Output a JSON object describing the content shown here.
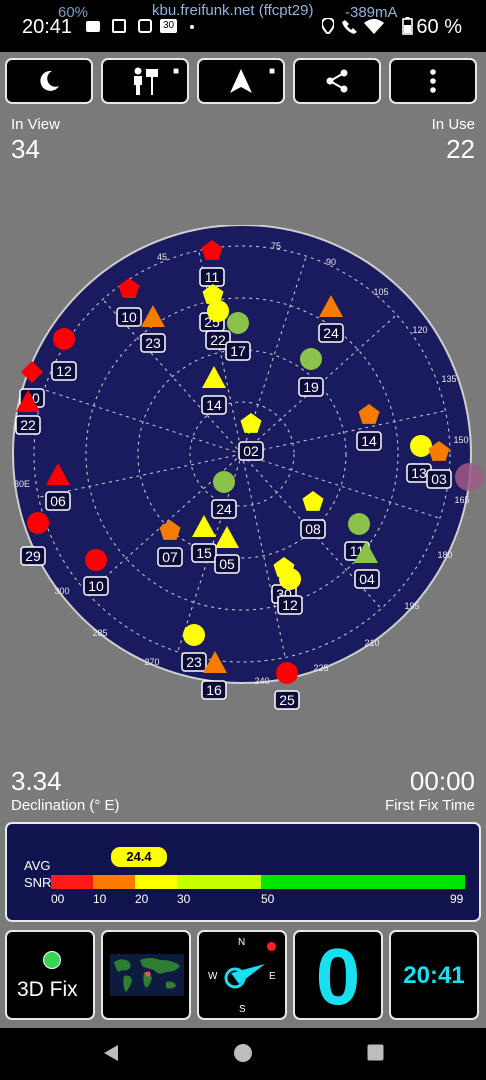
{
  "status_bar": {
    "time": "20:41",
    "battery_overlay": "60%",
    "host_info": "kbu.freifunk.net (ffcpt29)",
    "current": "-389mA",
    "battery": "60 %",
    "date_badge": "30",
    "left_icons": [
      "message-icon",
      "calendar-icon",
      "app-icon",
      "calendar-date-icon"
    ],
    "right_icons": [
      "location-icon",
      "wifi-calling-icon",
      "wifi-icon",
      "battery-icon"
    ]
  },
  "toolbar": {
    "buttons": [
      {
        "name": "night-mode-button",
        "icon": "moon-icon",
        "glyph": "☾",
        "locked": false
      },
      {
        "name": "map-guide-button",
        "icon": "person-sign-icon",
        "glyph": "⚑",
        "locked": true
      },
      {
        "name": "navigate-button",
        "icon": "navigation-arrow-icon",
        "glyph": "▲",
        "locked": true
      },
      {
        "name": "share-button",
        "icon": "share-icon",
        "glyph": "⋖",
        "locked": false
      },
      {
        "name": "menu-button",
        "icon": "more-vert-icon",
        "glyph": "⋮",
        "locked": false
      }
    ],
    "lock_glyph": "🔒"
  },
  "stats": {
    "in_view_label": "In View",
    "in_view_value": "34",
    "in_use_label": "In Use",
    "in_use_value": "22",
    "declination_value": "3.34",
    "declination_label": "Declination (° E)",
    "first_fix_value": "00:00",
    "first_fix_label": "First Fix Time"
  },
  "radar": {
    "azimuth_labels": [
      "45",
      "75",
      "90",
      "105",
      "120",
      "135",
      "150",
      "165",
      "180",
      "195",
      "210",
      "225",
      "240",
      "270",
      "285",
      "300",
      "30E"
    ],
    "colors": {
      "red": "#ff0000",
      "orange": "#f57c00",
      "yellow": "#ffff00",
      "lime": "#8bc34a",
      "green": "#7fd10e",
      "bg": "#1a1a5e"
    },
    "satellites": [
      {
        "label": "11",
        "shape": "pentagon",
        "color": "red"
      },
      {
        "label": "10",
        "shape": "pentagon",
        "color": "red"
      },
      {
        "label": "23",
        "shape": "triangle",
        "color": "orange"
      },
      {
        "label": "25",
        "shape": "pentagon",
        "color": "yellow"
      },
      {
        "label": "22",
        "shape": "circle",
        "color": "yellow"
      },
      {
        "label": "17",
        "shape": "circle",
        "color": "lime"
      },
      {
        "label": "24",
        "shape": "triangle",
        "color": "orange"
      },
      {
        "label": "19",
        "shape": "circle",
        "color": "lime"
      },
      {
        "label": "12",
        "shape": "circle",
        "color": "red"
      },
      {
        "label": "20",
        "shape": "diamond",
        "color": "red"
      },
      {
        "label": "22",
        "shape": "triangle",
        "color": "red"
      },
      {
        "label": "14",
        "shape": "triangle",
        "color": "yellow"
      },
      {
        "label": "14",
        "shape": "pentagon",
        "color": "orange"
      },
      {
        "label": "02",
        "shape": "pentagon",
        "color": "yellow"
      },
      {
        "label": "13",
        "shape": "circle",
        "color": "yellow"
      },
      {
        "label": "03",
        "shape": "pentagon",
        "color": "orange"
      },
      {
        "label": "06",
        "shape": "triangle",
        "color": "red"
      },
      {
        "label": "24",
        "shape": "circle",
        "color": "lime"
      },
      {
        "label": "08",
        "shape": "pentagon",
        "color": "yellow"
      },
      {
        "label": "11",
        "shape": "circle",
        "color": "lime"
      },
      {
        "label": "04",
        "shape": "triangle",
        "color": "lime"
      },
      {
        "label": "29",
        "shape": "circle",
        "color": "red"
      },
      {
        "label": "07",
        "shape": "pentagon",
        "color": "orange"
      },
      {
        "label": "15",
        "shape": "triangle",
        "color": "yellow"
      },
      {
        "label": "05",
        "shape": "triangle",
        "color": "yellow"
      },
      {
        "label": "10",
        "shape": "circle",
        "color": "red"
      },
      {
        "label": "30",
        "shape": "pentagon",
        "color": "yellow"
      },
      {
        "label": "12",
        "shape": "circle",
        "color": "yellow"
      },
      {
        "label": "23",
        "shape": "circle",
        "color": "yellow"
      },
      {
        "label": "16",
        "shape": "triangle",
        "color": "orange"
      },
      {
        "label": "25",
        "shape": "circle",
        "color": "red"
      }
    ]
  },
  "snr": {
    "avg_label": "AVG",
    "snr_label": "SNR",
    "avg_value": "24.4",
    "scale": [
      "00",
      "10",
      "20",
      "30",
      "50",
      "99"
    ],
    "segment_colors": [
      "#ff1a1a",
      "#ff7a00",
      "#ffff00",
      "#c6ff00",
      "#9cff00",
      "#00e600"
    ]
  },
  "bottom_tiles": {
    "fix_label": "3D Fix",
    "fix_color": "#39d353",
    "sats_used": "0",
    "time": "20:41",
    "compass_letters": [
      "N",
      "E",
      "S",
      "W"
    ],
    "accent": "#18e0f0"
  },
  "nav_bar": {
    "back_icon": "back-icon",
    "home_icon": "home-icon",
    "recents_icon": "recents-icon"
  }
}
